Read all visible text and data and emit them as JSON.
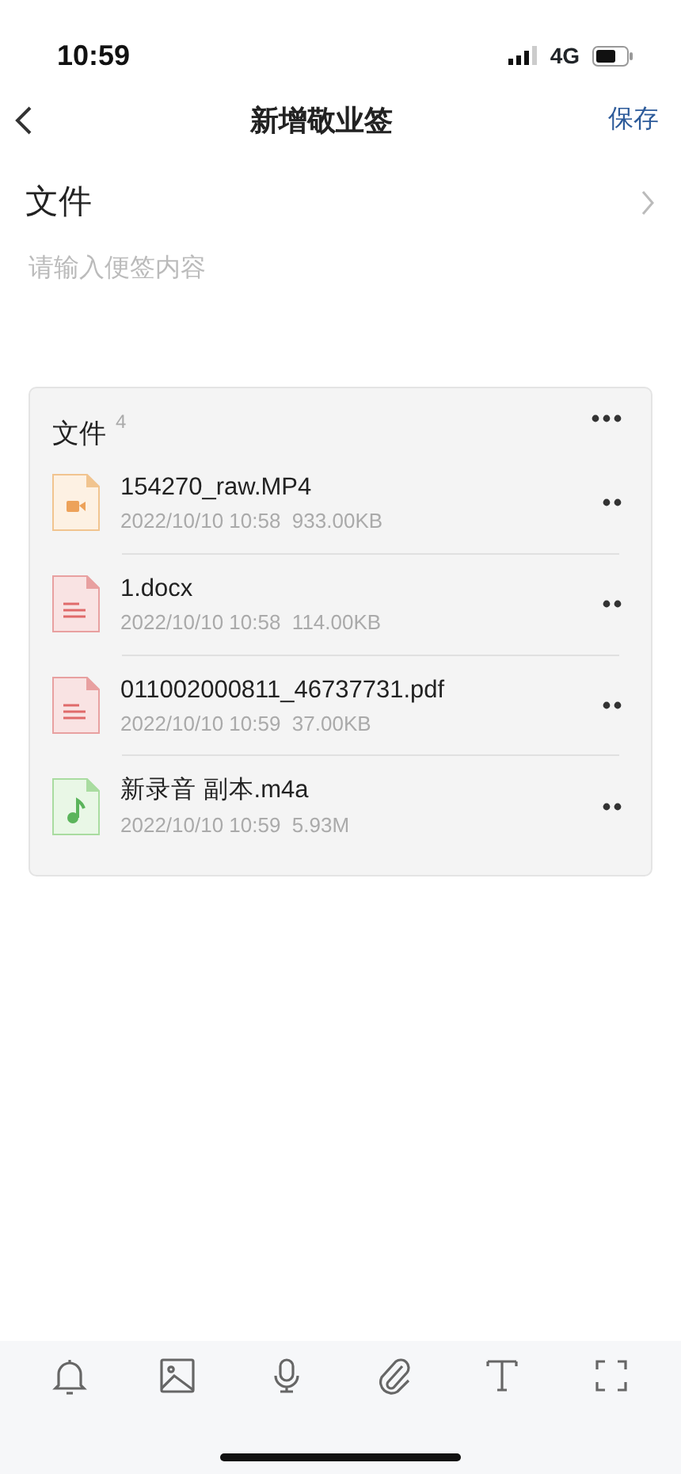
{
  "status_bar": {
    "time": "10:59",
    "network": "4G"
  },
  "nav": {
    "title": "新增敬业签",
    "save": "保存"
  },
  "folder": {
    "label": "文件"
  },
  "note": {
    "placeholder": "请输入便签内容"
  },
  "files_card": {
    "title": "文件",
    "count": "4",
    "items": [
      {
        "kind": "video",
        "name": "154270_raw.MP4",
        "meta": "2022/10/10 10:58  933.00KB"
      },
      {
        "kind": "doc",
        "name": "1.docx",
        "meta": "2022/10/10 10:58  114.00KB"
      },
      {
        "kind": "doc",
        "name": "011002000811_46737731.pdf",
        "meta": "2022/10/10 10:59  37.00KB"
      },
      {
        "kind": "audio",
        "name": "新录音 副本.m4a",
        "meta": "2022/10/10 10:59  5.93M"
      }
    ]
  },
  "toolbar": [
    {
      "kind": "bell"
    },
    {
      "kind": "image"
    },
    {
      "kind": "mic"
    },
    {
      "kind": "clip"
    },
    {
      "kind": "text"
    },
    {
      "kind": "expand"
    }
  ]
}
